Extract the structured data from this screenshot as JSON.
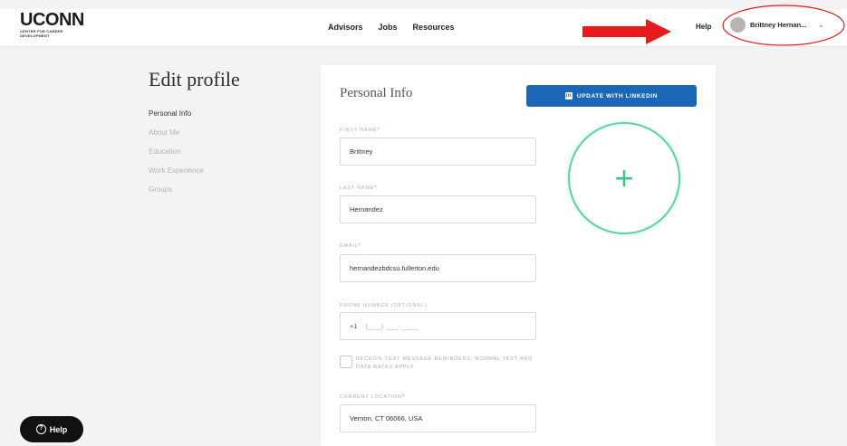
{
  "header": {
    "logo_text": "UCONN",
    "logo_subtext": "CENTER FOR CAREER DEVELOPMENT",
    "nav": [
      "Advisors",
      "Jobs",
      "Resources"
    ],
    "help_label": "Help",
    "user_name": "Brittney Hernan...",
    "annotation_color": "#e8191a"
  },
  "page": {
    "title": "Edit profile",
    "side_nav": [
      {
        "label": "Personal Info",
        "active": true
      },
      {
        "label": "About Me",
        "active": false
      },
      {
        "label": "Education",
        "active": false
      },
      {
        "label": "Work Experience",
        "active": false
      },
      {
        "label": "Groups",
        "active": false
      }
    ]
  },
  "card": {
    "title": "Personal Info",
    "linkedin_button": "UPDATE WITH LINKEDIN",
    "linkedin_icon": "in",
    "photo_upload_icon": "+",
    "fields": {
      "first_name": {
        "label": "FIRST NAME",
        "value": "Brittney"
      },
      "last_name": {
        "label": "LAST NAME",
        "value": "Hernandez"
      },
      "email": {
        "label": "EMAIL",
        "value": "hernandezbdcsu.fullerton.edu"
      },
      "phone": {
        "label": "PHONE NUMBER (OPTIONAL)",
        "prefix": "+1",
        "placeholder": "(___) ___-____"
      },
      "sms_checkbox": {
        "label": "RECEIVE TEXT MESSAGE REMINDERS. NORMAL TEXT AND DATA RATES APPLY."
      },
      "location": {
        "label": "CURRENT LOCATION",
        "value": "Vernon, CT 06066, USA"
      }
    },
    "required_marker": "*"
  },
  "help_fab": {
    "label": "Help",
    "icon": "?"
  }
}
